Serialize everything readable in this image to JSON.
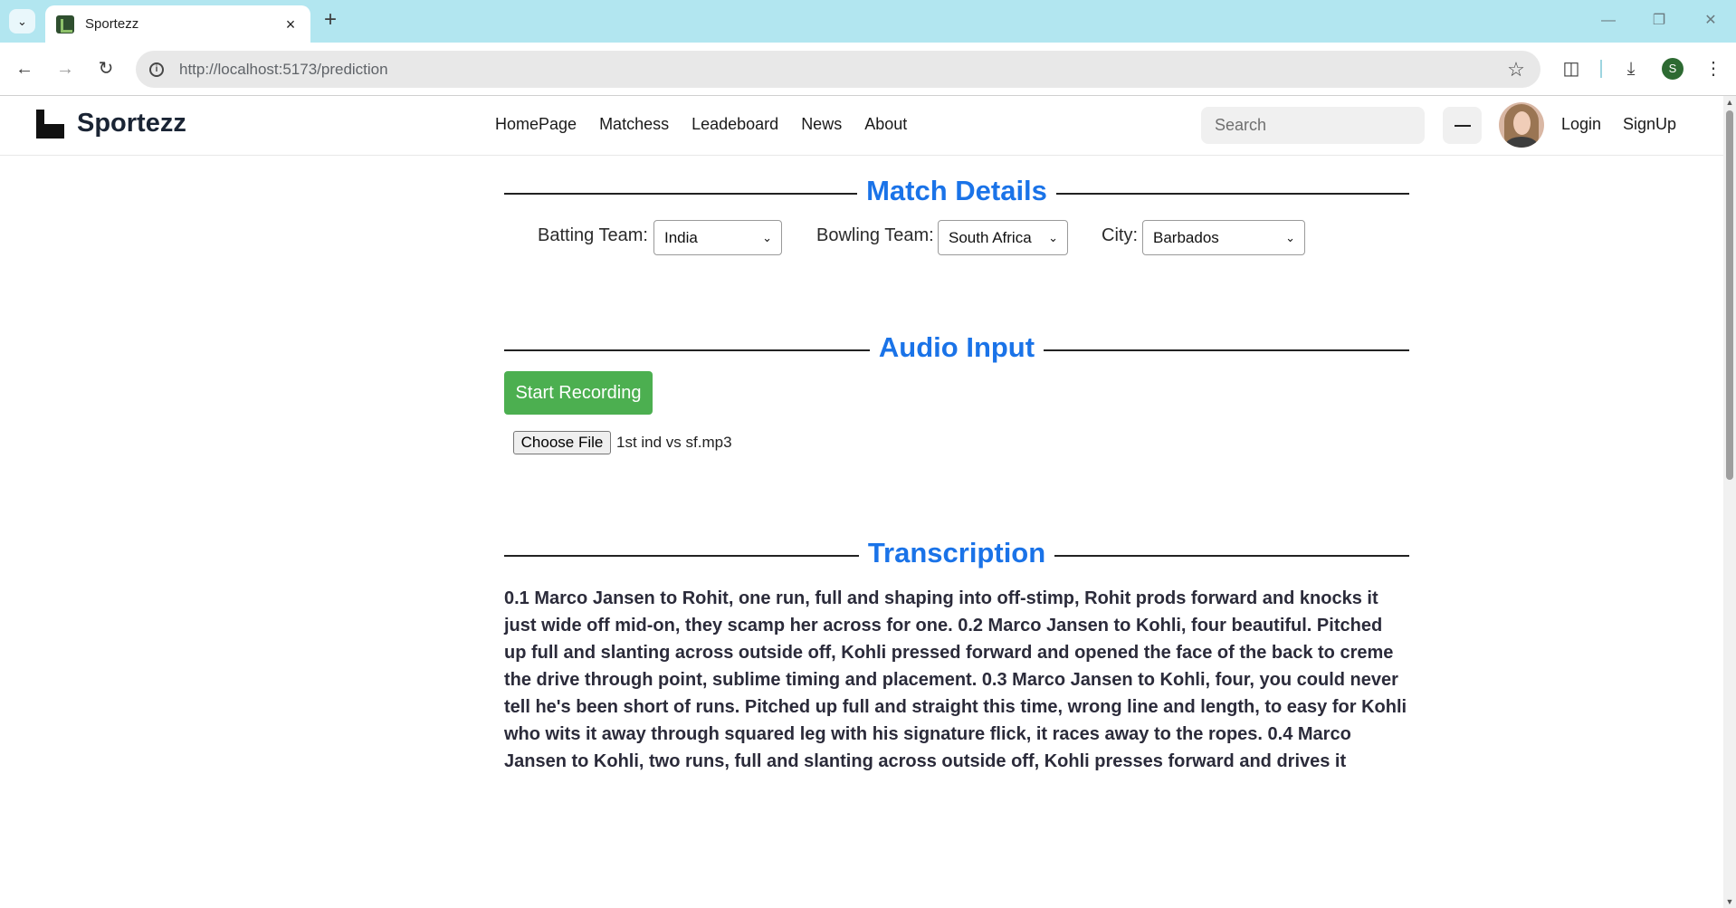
{
  "browser": {
    "tab_title": "Sportezz",
    "url": "http://localhost:5173/prediction",
    "profile_initial": "S"
  },
  "site": {
    "brand": "Sportezz",
    "nav_links": [
      "HomePage",
      "Matchess",
      "Leadeboard",
      "News",
      "About"
    ],
    "search_placeholder": "Search",
    "login_label": "Login",
    "signup_label": "SignUp"
  },
  "match_details": {
    "heading": "Match Details",
    "batting_label": "Batting Team:",
    "batting_value": "India",
    "bowling_label": "Bowling Team:",
    "bowling_value": "South Africa",
    "city_label": "City:",
    "city_value": "Barbados"
  },
  "audio_input": {
    "heading": "Audio Input",
    "record_label": "Start Recording",
    "choose_file_label": "Choose File",
    "file_name": "1st ind vs sf.mp3"
  },
  "transcription": {
    "heading": "Transcription",
    "text": "0.1 Marco Jansen to Rohit, one run, full and shaping into off-stimp, Rohit prods forward and knocks it just wide off mid-on, they scamp her across for one. 0.2 Marco Jansen to Kohli, four beautiful. Pitched up full and slanting across outside off, Kohli pressed forward and opened the face of the back to creme the drive through point, sublime timing and placement. 0.3 Marco Jansen to Kohli, four, you could never tell he's been short of runs. Pitched up full and straight this time, wrong line and length, to easy for Kohli who wits it away through squared leg with his signature flick, it races away to the ropes. 0.4 Marco Jansen to Kohli, two runs, full and slanting across outside off, Kohli presses forward and drives it"
  },
  "colors": {
    "tabstrip": "#b2e6f0",
    "accent_heading": "#1a73e8",
    "record_button": "#4caf50"
  }
}
